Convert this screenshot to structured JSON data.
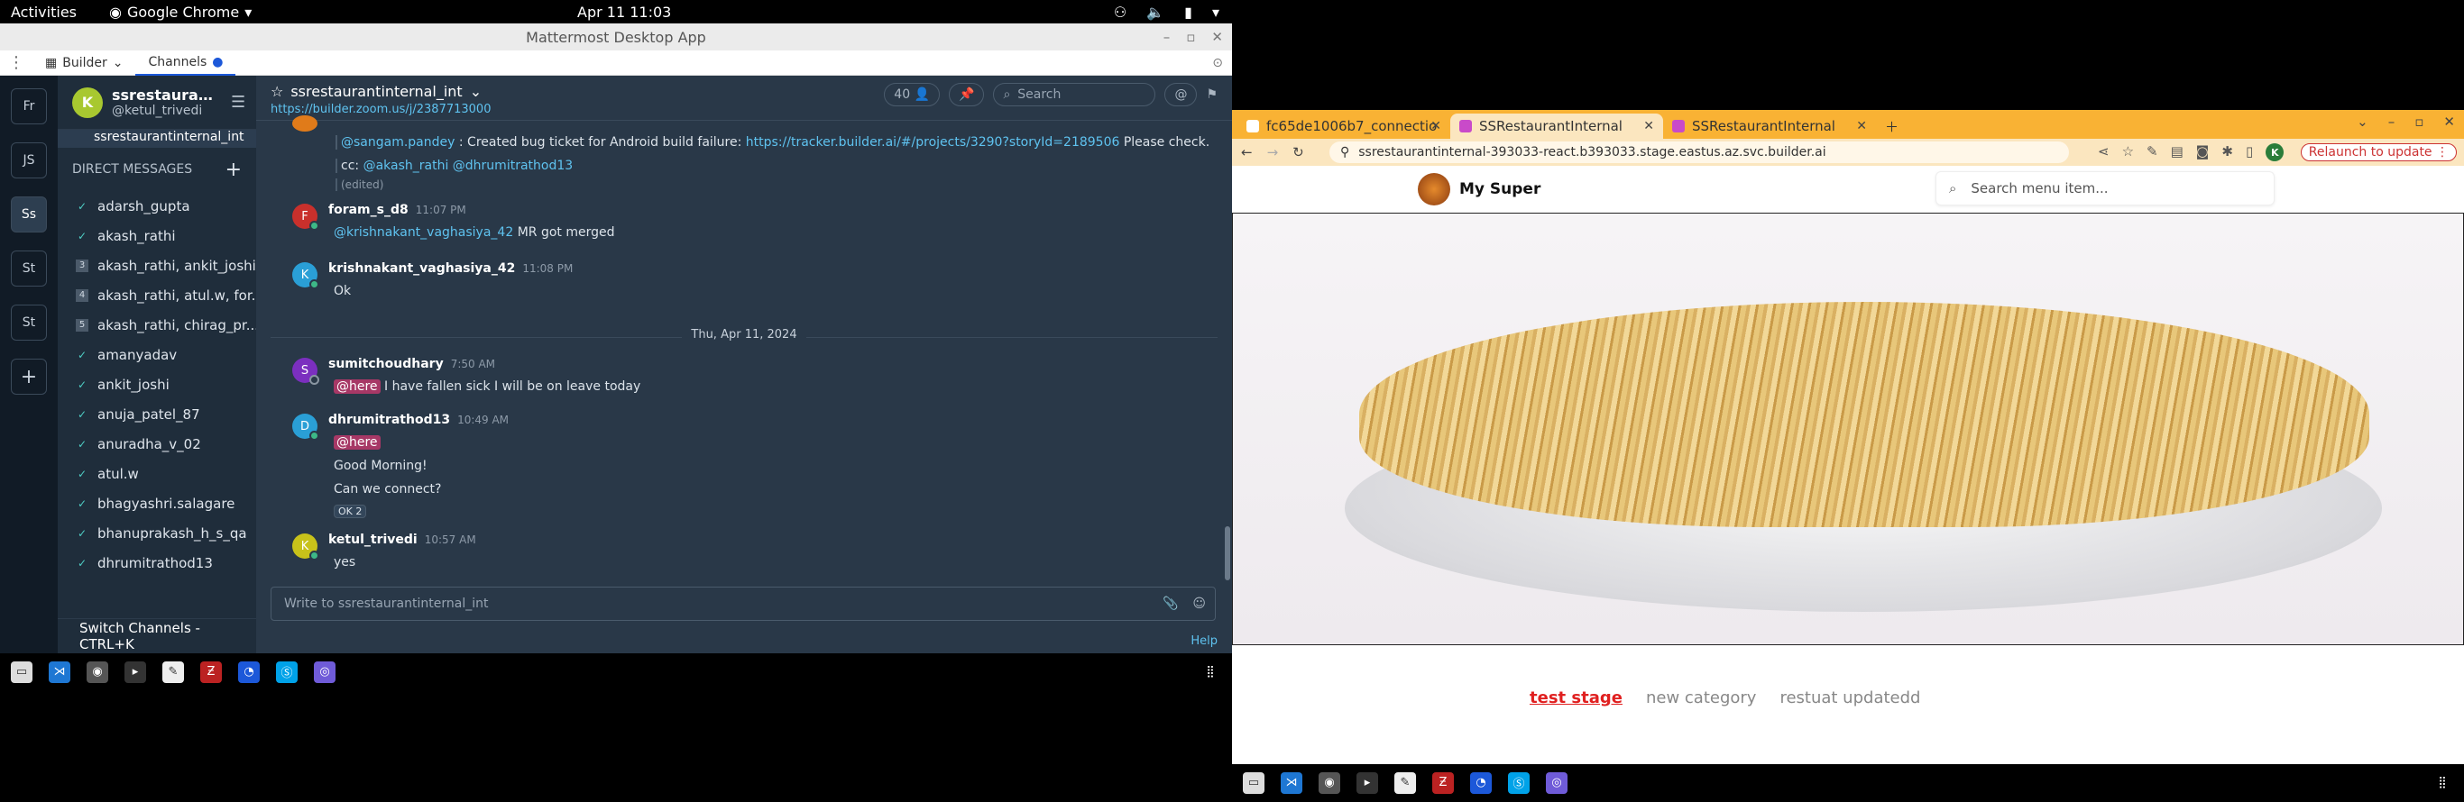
{
  "topbar": {
    "activities": "Activities",
    "app": "Google Chrome",
    "clock": "Apr 11  11:03"
  },
  "mattermost": {
    "title": "Mattermost Desktop App",
    "tabs": [
      {
        "label": "Builder"
      },
      {
        "label": "Channels"
      }
    ],
    "servers": [
      "Fr",
      "JS",
      "Ss",
      "St",
      "St"
    ],
    "team": {
      "name": "ssrestaurantint...",
      "user": "@ketul_trivedi"
    },
    "current_channel": "ssrestaurantinternal_int",
    "dm_header": "DIRECT MESSAGES",
    "dms": [
      "adarsh_gupta",
      "akash_rathi",
      "akash_rathi, ankit_joshi...",
      "akash_rathi, atul.w, for...",
      "akash_rathi, chirag_pr...",
      "amanyadav",
      "ankit_joshi",
      "anuja_patel_87",
      "anuradha_v_02",
      "atul.w",
      "bhagyashri.salagare",
      "bhanuprakash_h_s_qa",
      "dhrumitrathod13"
    ],
    "dm_groups": [
      "3",
      "4",
      "5"
    ],
    "switch": "Switch Channels - CTRL+K",
    "channel": {
      "name": "ssrestaurantinternal_int",
      "link": "https://builder.zoom.us/j/2387713000",
      "members": "40",
      "search_placeholder": "Search"
    },
    "posts": [
      {
        "mention": "@sangam.pandey",
        "text": " : Created bug ticket for Android build failure: ",
        "link": "https://tracker.builder.ai/#/projects/3290?storyId=2189506",
        "tail": " Please check.",
        "cc": "cc: ",
        "cc_mentions": "@akash_rathi @dhrumitrathod13",
        "edited": "(edited)"
      },
      {
        "initial": "F",
        "author": "foram_s_d8",
        "time": "11:07 PM",
        "mention": "@krishnakant_vaghasiya_42",
        "text": " MR got merged"
      },
      {
        "initial": "K",
        "author": "krishnakant_vaghasiya_42",
        "time": "11:08 PM",
        "text": "Ok"
      },
      {
        "initial": "S",
        "author": "sumitchoudhary",
        "time": "7:50 AM",
        "mention": "@here",
        "text": " I have fallen sick I will be on leave today"
      },
      {
        "initial": "D",
        "author": "dhrumitrathod13",
        "time": "10:49 AM",
        "mention": "@here",
        "line2": "Good Morning!",
        "line3": "Can we connect?",
        "reaction": "OK 2"
      },
      {
        "initial": "K",
        "author": "ketul_trivedi",
        "time": "10:57 AM",
        "text": "yes"
      }
    ],
    "date_separator": "Thu, Apr 11, 2024",
    "compose_placeholder": "Write to ssrestaurantinternal_int",
    "help": "Help"
  },
  "chrome": {
    "tabs": [
      {
        "label": "fc65de1006b7_connectio"
      },
      {
        "label": "SSRestaurantInternal"
      },
      {
        "label": "SSRestaurantInternal"
      }
    ],
    "url": "ssrestaurantinternal-393033-react.b393033.stage.eastus.az.svc.builder.ai",
    "relaunch": "Relaunch to update",
    "profile": "K",
    "site": {
      "brand": "My Super",
      "search_placeholder": "Search menu item...",
      "categories": [
        "test stage",
        "new category",
        "restuat updatedd"
      ]
    }
  },
  "colors": {
    "accent": "#5fc3f0",
    "here_badge": "#a73866",
    "chrome_tab": "#f9b234"
  }
}
